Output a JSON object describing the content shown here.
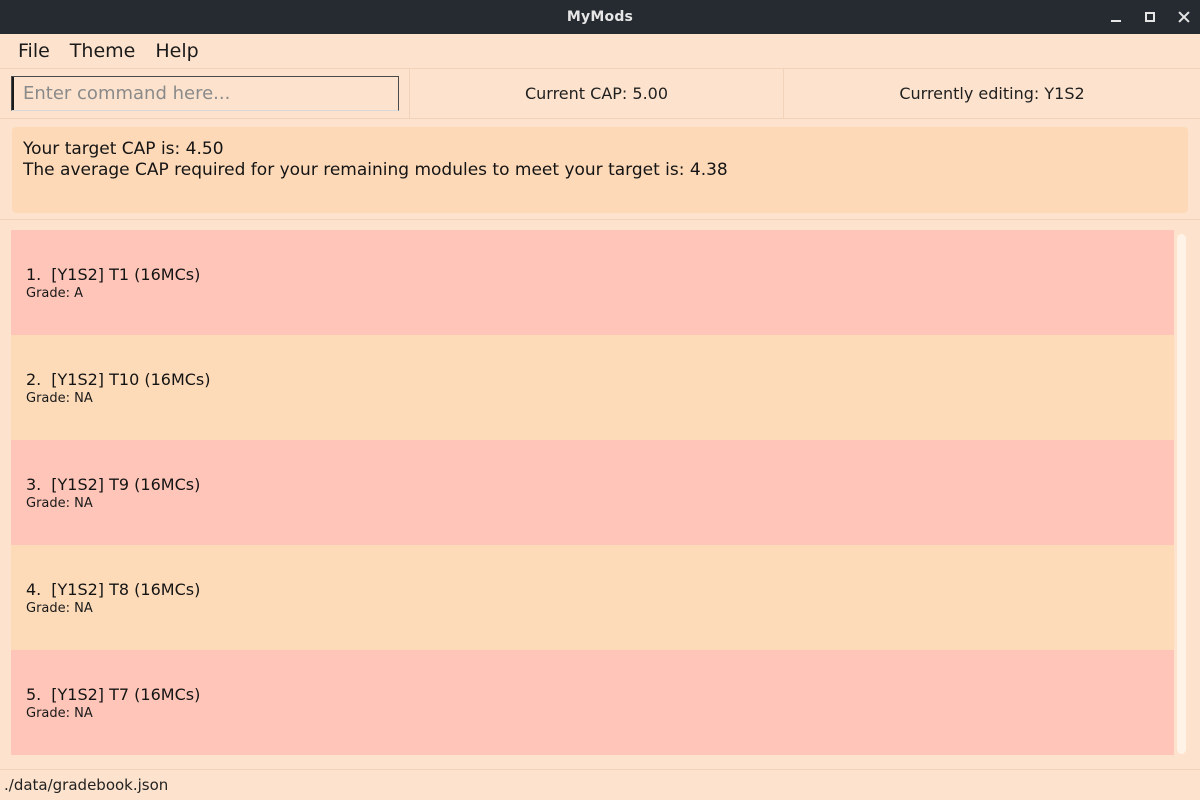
{
  "window": {
    "title": "MyMods"
  },
  "menu": {
    "items": [
      "File",
      "Theme",
      "Help"
    ]
  },
  "command": {
    "placeholder": "Enter command here...",
    "value": ""
  },
  "status_top": {
    "current_cap": "Current CAP: 5.00",
    "currently_editing": "Currently editing: Y1S2"
  },
  "target": {
    "line1": "Your target CAP is: 4.50",
    "line2": "The average CAP required for your remaining modules to meet your target is: 4.38"
  },
  "modules": [
    {
      "index": "1.",
      "title": "[Y1S2] T1 (16MCs)",
      "grade": "Grade: A"
    },
    {
      "index": "2.",
      "title": "[Y1S2] T10 (16MCs)",
      "grade": "Grade: NA"
    },
    {
      "index": "3.",
      "title": "[Y1S2] T9 (16MCs)",
      "grade": "Grade: NA"
    },
    {
      "index": "4.",
      "title": "[Y1S2] T8 (16MCs)",
      "grade": "Grade: NA"
    },
    {
      "index": "5.",
      "title": "[Y1S2] T7 (16MCs)",
      "grade": "Grade: NA"
    }
  ],
  "statusbar": {
    "path": "./data/gradebook.json"
  },
  "colors": {
    "background": "#fde3cd",
    "titlebar": "#252b30",
    "card_odd": "#fec5b8",
    "card_even": "#fddbb9",
    "target_panel": "#fdd9b8"
  }
}
